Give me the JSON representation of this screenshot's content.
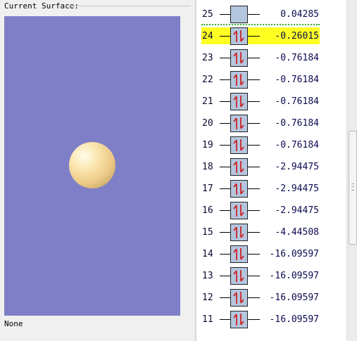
{
  "left_panel": {
    "title": "Current Surface:",
    "selection": "None",
    "viewer_background": "#7f7fc7",
    "sphere_color": "#f3d79b"
  },
  "orbitals": [
    {
      "index": "25",
      "energy": "0.04285",
      "occupancy": "empty",
      "homo": false
    },
    {
      "index": "24",
      "energy": "-0.26015",
      "occupancy": "paired",
      "homo": true
    },
    {
      "index": "23",
      "energy": "-0.76184",
      "occupancy": "paired",
      "homo": false
    },
    {
      "index": "22",
      "energy": "-0.76184",
      "occupancy": "paired",
      "homo": false
    },
    {
      "index": "21",
      "energy": "-0.76184",
      "occupancy": "paired",
      "homo": false
    },
    {
      "index": "20",
      "energy": "-0.76184",
      "occupancy": "paired",
      "homo": false
    },
    {
      "index": "19",
      "energy": "-0.76184",
      "occupancy": "paired",
      "homo": false
    },
    {
      "index": "18",
      "energy": "-2.94475",
      "occupancy": "paired",
      "homo": false
    },
    {
      "index": "17",
      "energy": "-2.94475",
      "occupancy": "paired",
      "homo": false
    },
    {
      "index": "16",
      "energy": "-2.94475",
      "occupancy": "paired",
      "homo": false
    },
    {
      "index": "15",
      "energy": "-4.44508",
      "occupancy": "paired",
      "homo": false
    },
    {
      "index": "14",
      "energy": "-16.09597",
      "occupancy": "paired",
      "homo": false
    },
    {
      "index": "13",
      "energy": "-16.09597",
      "occupancy": "paired",
      "homo": false
    },
    {
      "index": "12",
      "energy": "-16.09597",
      "occupancy": "paired",
      "homo": false
    },
    {
      "index": "11",
      "energy": "-16.09597",
      "occupancy": "paired",
      "homo": false
    }
  ],
  "colors": {
    "homo_highlight": "#ffff22",
    "electron_arrow": "#d01010",
    "occupied_box": "#b4c6de"
  }
}
